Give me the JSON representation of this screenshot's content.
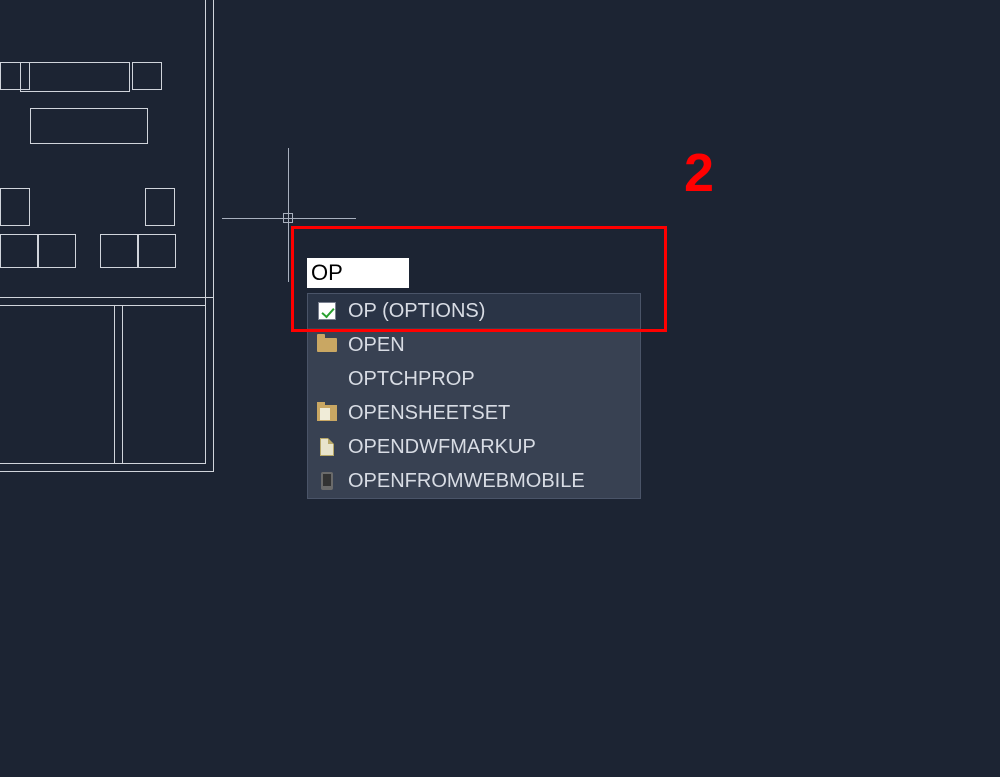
{
  "command_input": {
    "value": "OP"
  },
  "autocomplete": {
    "items": [
      {
        "label": "OP (OPTIONS)",
        "icon": "checkbox",
        "selected": true
      },
      {
        "label": "OPEN",
        "icon": "folder",
        "selected": false
      },
      {
        "label": "OPTCHPROP",
        "icon": "blank",
        "selected": false
      },
      {
        "label": "OPENSHEETSET",
        "icon": "folder-sheet",
        "selected": false
      },
      {
        "label": "OPENDWFMARKUP",
        "icon": "doc",
        "selected": false
      },
      {
        "label": "OPENFROMWEBMOBILE",
        "icon": "mobile",
        "selected": false
      }
    ]
  },
  "annotation": {
    "number": "2"
  }
}
